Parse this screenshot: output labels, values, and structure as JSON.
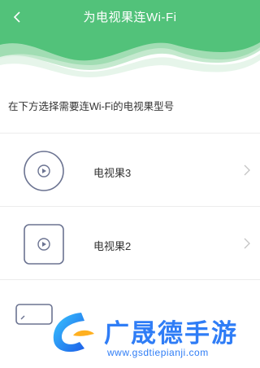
{
  "header": {
    "title": "为电视果连Wi-Fi",
    "back_icon": "chevron-left-icon",
    "accent_color": "#4cc57a"
  },
  "instruction": "在下方选择需要连Wi-Fi的电视果型号",
  "devices": [
    {
      "label": "电视果3",
      "icon": "round-device-icon"
    },
    {
      "label": "电视果2",
      "icon": "square-device-icon"
    },
    {
      "label": "",
      "icon": "stick-device-icon"
    }
  ],
  "watermark": {
    "brand": "广晟德手游",
    "url": "www.gsdtiepianji.com"
  }
}
